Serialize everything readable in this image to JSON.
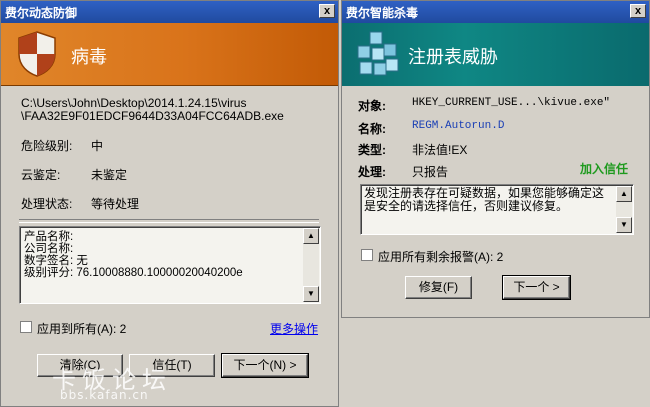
{
  "dialog1": {
    "title": "费尔动态防御",
    "close": "x",
    "banner_title": "病毒",
    "path_line1": "C:\\Users\\John\\Desktop\\2014.1.24.15\\virus",
    "path_line2": "\\FAA32E9F01EDCF9644D33A04FCC64ADB.exe",
    "danger_label": "危险级别:",
    "danger_value": "中",
    "cloud_label": "云鉴定:",
    "cloud_value": "未鉴定",
    "status_label": "处理状态:",
    "status_value": "等待处理",
    "details": [
      "产品名称:",
      "公司名称:",
      "数字签名: 无",
      "级别评分: 76.10008880.10000020040200e"
    ],
    "apply_all": "应用到所有(A): 2",
    "more_ops": "更多操作",
    "buttons": {
      "clear": "清除(C)",
      "trust": "信任(T)",
      "next": "下一个(N) >"
    }
  },
  "dialog2": {
    "title": "费尔智能杀毒",
    "close": "x",
    "banner_title": "注册表威胁",
    "object_label": "对象:",
    "object_value": "HKEY_CURRENT_USE...\\kivue.exe\"",
    "name_label": "名称:",
    "name_value": "REGM.Autorun.D",
    "type_label": "类型:",
    "type_value": "非法值!EX",
    "action_label": "处理:",
    "action_value": "只报告",
    "add_trust": "加入信任",
    "message": "发现注册表存在可疑数据，如果您能够确定这是安全的请选择信任，否则建议修复。",
    "apply_all": "应用所有剩余报警(A): 2",
    "buttons": {
      "repair": "修复(F)",
      "next": "下一个 >"
    }
  },
  "watermark": {
    "main": "卡饭论坛",
    "sub": "bbs.kafan.cn"
  },
  "colors": {
    "titlebar": "#2f61c4",
    "banner1": "#d9731a",
    "banner2": "#0f8784",
    "link": "#0000ee",
    "green": "#1e9a1e"
  }
}
